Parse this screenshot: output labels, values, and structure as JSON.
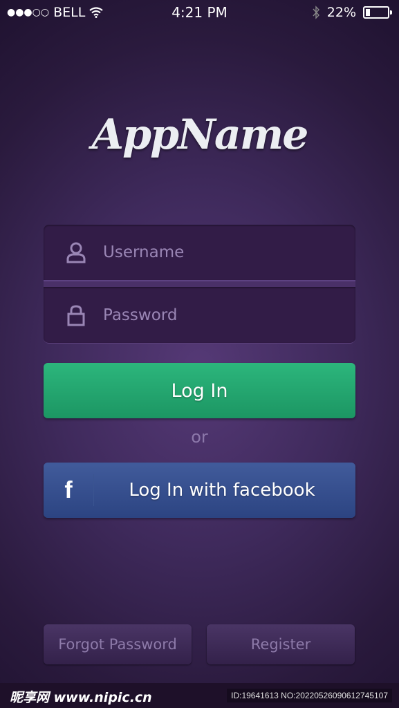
{
  "status_bar": {
    "signal_dots": "●●●○○",
    "carrier": "BELL",
    "wifi_icon": "wifi-icon",
    "time": "4:21 PM",
    "bluetooth_icon": "bluetooth-icon",
    "battery_percent": "22%",
    "battery_level": 0.22
  },
  "app": {
    "name": "AppName"
  },
  "form": {
    "username": {
      "placeholder": "Username",
      "value": "",
      "icon": "user-icon"
    },
    "password": {
      "placeholder": "Password",
      "value": "",
      "icon": "lock-icon"
    }
  },
  "buttons": {
    "login": "Log In",
    "or": "or",
    "facebook_icon_glyph": "f",
    "facebook": "Log In with facebook",
    "forgot": "Forgot Password",
    "register": "Register"
  },
  "colors": {
    "login_green": "#24a870",
    "facebook_blue": "#35508f",
    "background_purple": "#3f2a5c"
  },
  "watermark": {
    "site": "昵享网 www.nipic.cn",
    "id": "ID:19641613 NO:20220526090612745107"
  }
}
